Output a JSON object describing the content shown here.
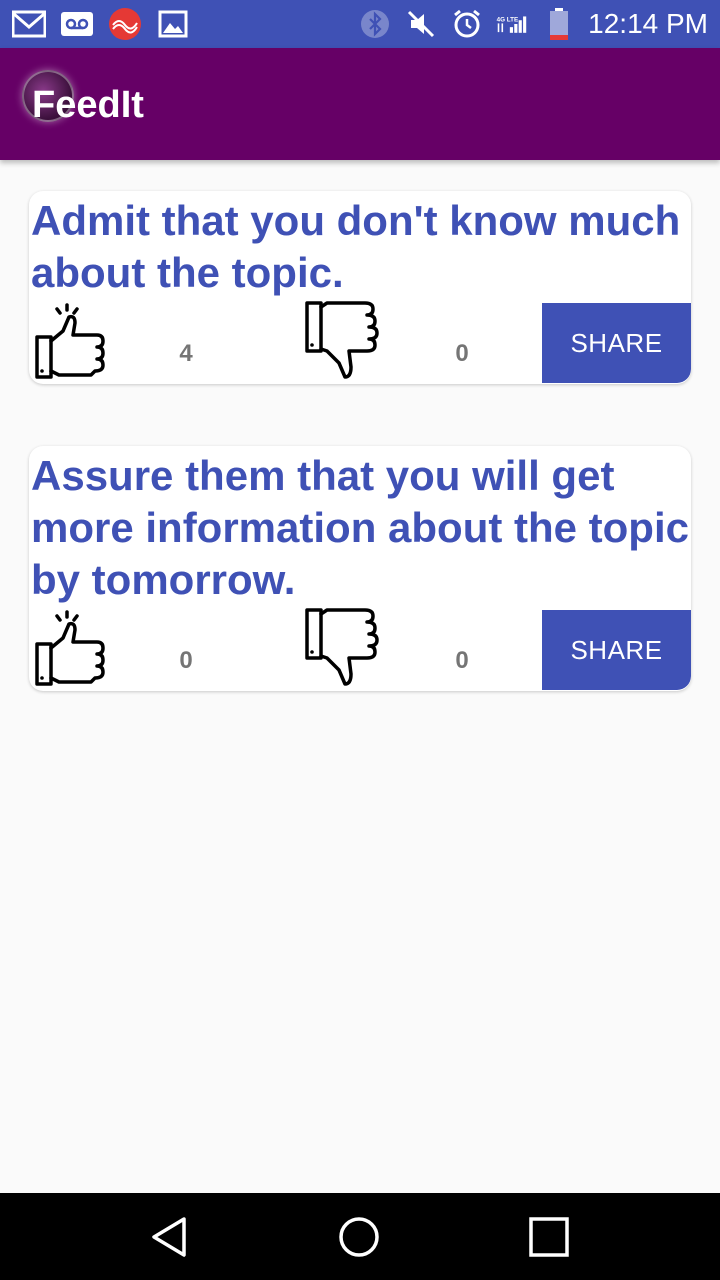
{
  "status_bar": {
    "time": "12:14 PM",
    "network": "4G LTE",
    "left_icons": [
      "gmail-icon",
      "voicemail-icon",
      "app-notification-icon",
      "image-icon"
    ],
    "right_icons": [
      "bluetooth-icon",
      "mute-icon",
      "alarm-icon",
      "signal-icon",
      "battery-icon"
    ]
  },
  "app_bar": {
    "title": "FeedIt"
  },
  "cards": [
    {
      "text": "Admit that you don't know much about the topic.",
      "likes": "4",
      "dislikes": "0",
      "share_label": "SHARE"
    },
    {
      "text": "Assure them that you will get more information about the topic by tomorrow.",
      "likes": "0",
      "dislikes": "0",
      "share_label": "SHARE"
    }
  ],
  "nav_bar": {
    "buttons": [
      "back",
      "home",
      "recents"
    ]
  },
  "colors": {
    "status_bar": "#3f51b5",
    "app_bar": "#660066",
    "accent": "#3f51b5",
    "count_text": "#757575",
    "background": "#fafafa"
  }
}
